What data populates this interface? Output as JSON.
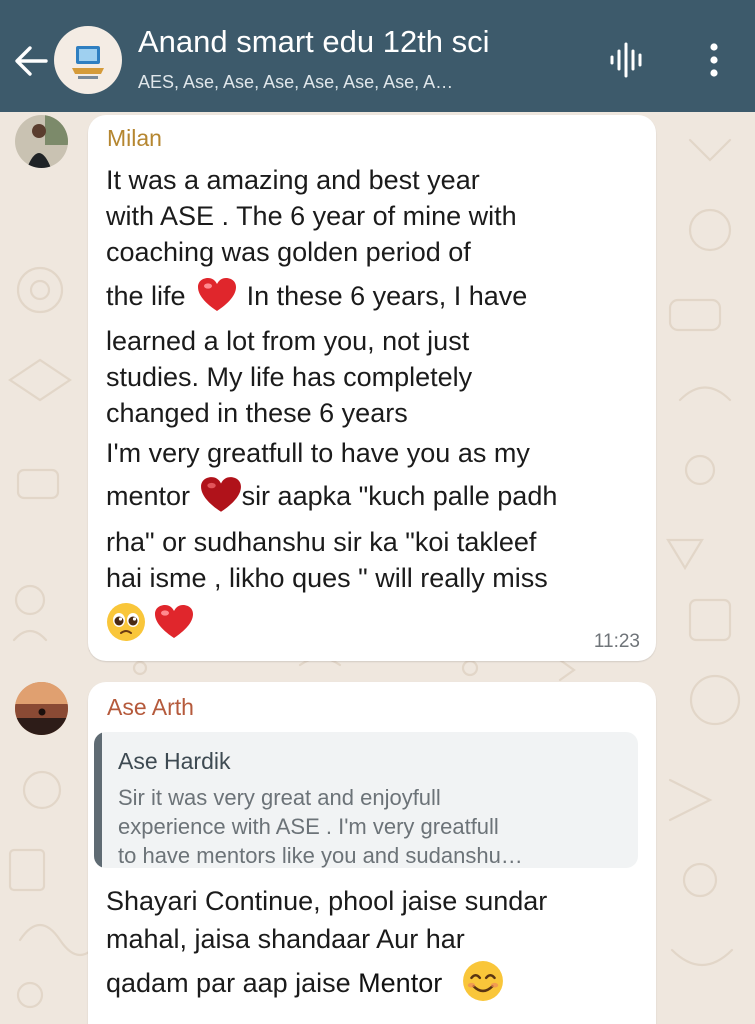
{
  "header": {
    "title": "Anand smart edu 12th sci",
    "subtitle": "AES, Ase, Ase, Ase, Ase, Ase, Ase, A…",
    "colors": {
      "bar": "#3d5a6b",
      "text": "#ffffff"
    },
    "icons": [
      "back-arrow-icon",
      "group-avatar",
      "audio-wave-icon",
      "more-vert-icon"
    ]
  },
  "messages": [
    {
      "sender": "Milan",
      "sender_color": "#b58630",
      "lines": [
        "It was a amazing and best year",
        "with ASE . The 6 year of mine with",
        "coaching was golden period of",
        "the life",
        " In these 6 years, I have",
        "learned a lot from you, not just",
        "studies. My life has completely",
        "changed in these 6 years",
        " I'm very greatfull to have  you as my",
        "mentor",
        "sir aapka \"kuch palle padh",
        "rha\" or sudhanshu sir ka \"koi takleef",
        "hai isme , likho ques \" will really miss"
      ],
      "emojis": [
        "red-heart",
        "red-heart",
        "pleading-face",
        "red-heart"
      ],
      "time": "11:23"
    },
    {
      "sender": "Ase Arth",
      "sender_color": "#b55a3c",
      "quote": {
        "sender": "Ase Hardik",
        "lines": [
          "Sir it was very great and enjoyfull",
          "experience with ASE . I'm very greatfull",
          "to have mentors like you and sudanshu…"
        ]
      },
      "lines": [
        "Shayari Continue, phool jaise sundar",
        "mahal, jaisa shandaar  Aur har",
        "qadam par aap jaise "
      ],
      "bold_word": "Mentor",
      "emojis": [
        "smiling-face"
      ]
    }
  ]
}
